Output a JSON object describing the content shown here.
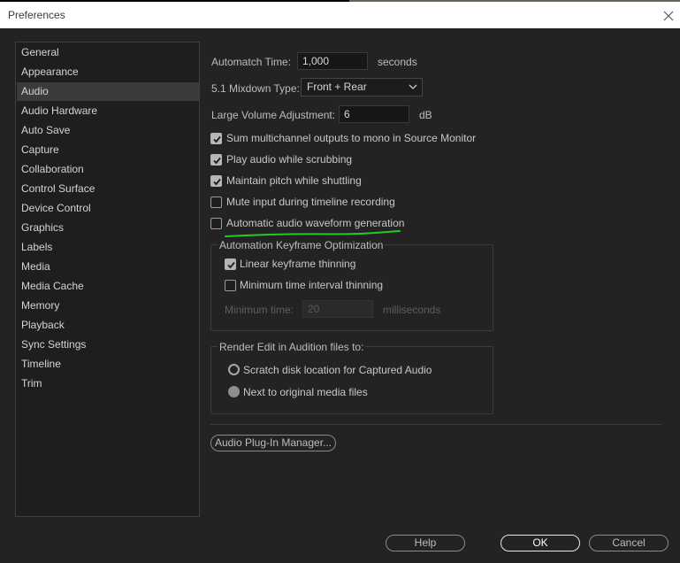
{
  "window": {
    "title": "Preferences"
  },
  "sidebar": {
    "items": [
      {
        "label": "General"
      },
      {
        "label": "Appearance"
      },
      {
        "label": "Audio",
        "selected": true
      },
      {
        "label": "Audio Hardware"
      },
      {
        "label": "Auto Save"
      },
      {
        "label": "Capture"
      },
      {
        "label": "Collaboration"
      },
      {
        "label": "Control Surface"
      },
      {
        "label": "Device Control"
      },
      {
        "label": "Graphics"
      },
      {
        "label": "Labels"
      },
      {
        "label": "Media"
      },
      {
        "label": "Media Cache"
      },
      {
        "label": "Memory"
      },
      {
        "label": "Playback"
      },
      {
        "label": "Sync Settings"
      },
      {
        "label": "Timeline"
      },
      {
        "label": "Trim"
      }
    ]
  },
  "audio": {
    "automatch": {
      "label": "Automatch Time:",
      "value": "1,000",
      "unit": "seconds"
    },
    "mixdown": {
      "label": "5.1 Mixdown Type:",
      "value": "Front + Rear"
    },
    "large_volume": {
      "label": "Large Volume Adjustment:",
      "value": "6",
      "unit": "dB"
    },
    "checkboxes": [
      {
        "label": "Sum multichannel outputs to mono in Source Monitor",
        "checked": true
      },
      {
        "label": "Play audio while scrubbing",
        "checked": true
      },
      {
        "label": "Maintain pitch while shuttling",
        "checked": true
      },
      {
        "label": "Mute input during timeline recording",
        "checked": false
      },
      {
        "label": "Automatic audio waveform generation",
        "checked": false
      }
    ],
    "annotation_color": "#22cc22",
    "keyframe_group": {
      "title": "Automation Keyframe Optimization",
      "linear": {
        "label": "Linear keyframe thinning",
        "checked": true
      },
      "minimum": {
        "label": "Minimum time interval thinning",
        "checked": false
      },
      "min_time": {
        "label": "Minimum time:",
        "value": "20",
        "unit": "milliseconds"
      }
    },
    "render_group": {
      "title": "Render Edit in Audition files to:",
      "option1": {
        "label": "Scratch disk location for Captured Audio",
        "selected": false
      },
      "option2": {
        "label": "Next to original media files",
        "selected": true
      }
    },
    "plugin_button": "Audio Plug-In Manager..."
  },
  "footer": {
    "help": "Help",
    "ok": "OK",
    "cancel": "Cancel"
  },
  "colors": {
    "background": "#232323",
    "sidebar": "#1e1e1e",
    "selected": "#3b3b3b"
  }
}
